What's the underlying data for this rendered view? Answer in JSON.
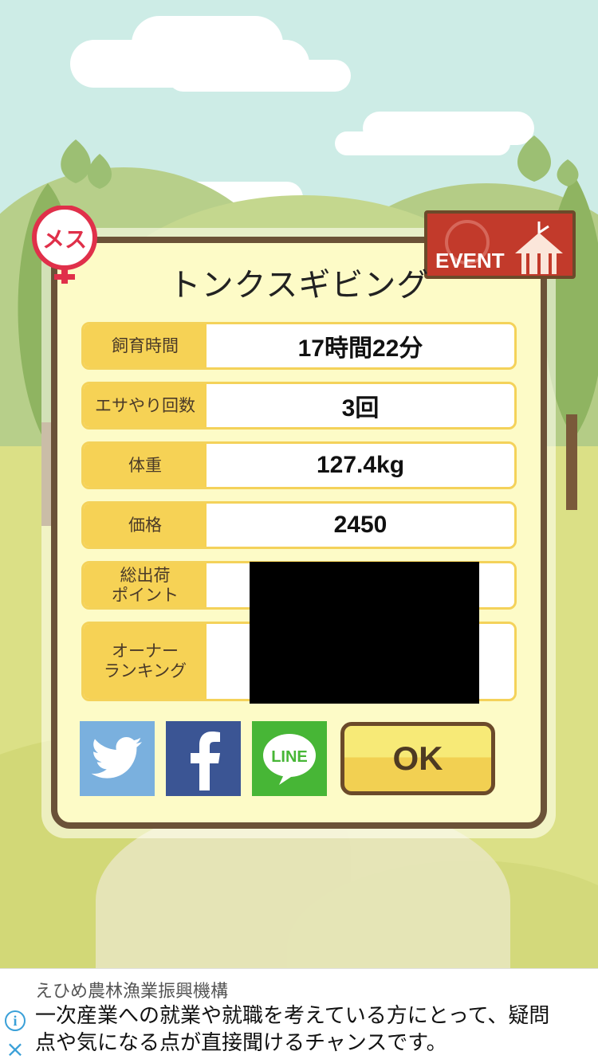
{
  "pig": {
    "name": "トンクスギビング",
    "gender_badge": "メス"
  },
  "event_badge": {
    "label": "EVENT"
  },
  "stats": [
    {
      "label": "飼育時間",
      "value": "17時間22分"
    },
    {
      "label": "エサやり回数",
      "value": "3回"
    },
    {
      "label": "体重",
      "value": "127.4kg"
    },
    {
      "label": "価格",
      "value": "2450"
    },
    {
      "label_line1": "総出荷",
      "label_line2": "ポイント",
      "value": ""
    },
    {
      "label_line1": "オーナー",
      "label_line2": "ランキング",
      "value": ""
    }
  ],
  "share": {
    "line_label": "LINE"
  },
  "ok_button": {
    "label": "OK"
  },
  "ad": {
    "sponsor": "えひめ農林漁業振興機構",
    "line1": "一次産業への就業や就職を考えている方にとって、疑問",
    "line2": "点や気になる点が直接聞けるチャンスです。"
  },
  "colors": {
    "accent_yellow": "#f6d255",
    "frame_brown": "#6b5238",
    "event_red": "#c23a2b",
    "twitter": "#7ab0de",
    "facebook": "#3b5594",
    "line": "#47b636"
  }
}
